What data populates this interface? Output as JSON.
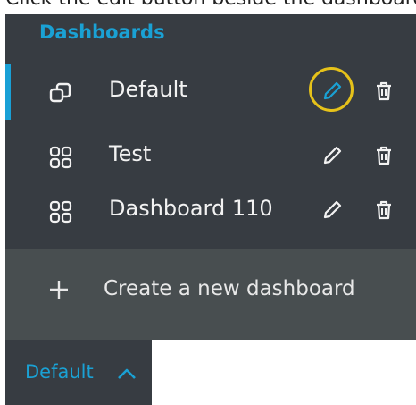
{
  "caption": "Click the edit button beside the dashboard",
  "sidebar": {
    "title": "Dashboards",
    "items": [
      {
        "label": "Default",
        "icon": "copy-icon",
        "active": true,
        "edit_highlighted": true
      },
      {
        "label": "Test",
        "icon": "grid-icon",
        "active": false
      },
      {
        "label": "Dashboard 110",
        "icon": "grid-icon",
        "active": false
      }
    ],
    "create_label": "Create a new dashboard"
  },
  "footer": {
    "current_dashboard": "Default"
  },
  "colors": {
    "accent": "#1aa1d4",
    "panel_bg": "#373c42",
    "create_bg": "#484e50",
    "highlight_ring": "#e6c21a",
    "text": "#f2f2f2"
  }
}
